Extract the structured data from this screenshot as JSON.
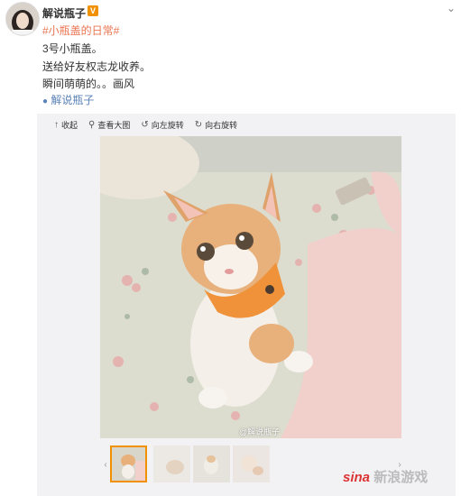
{
  "header": {
    "username": "解说瓶子",
    "verified_badge": "V",
    "menu_icon": "chevron-down-icon"
  },
  "post": {
    "topic": "#小瓶盖的日常#",
    "line1": "3号小瓶盖。",
    "line2": "送给好友权志龙收养。",
    "line3": "瞬间萌萌的。。画风",
    "source_link": "解说瓶子"
  },
  "toolbar": {
    "collapse": "收起",
    "view_large": "查看大图",
    "rotate_left": "向左旋转",
    "rotate_right": "向右旋转"
  },
  "photo": {
    "watermark": "@解说瓶子"
  },
  "thumbnails": {
    "prev_icon": "chevron-left-icon",
    "next_icon": "chevron-right-icon",
    "count": 4,
    "selected": 1
  },
  "site_watermark": {
    "part1": "sina",
    "part2": "新浪游戏"
  },
  "colors": {
    "topic": "#eb7350",
    "link": "#5a82b8",
    "badge": "#f29100"
  }
}
